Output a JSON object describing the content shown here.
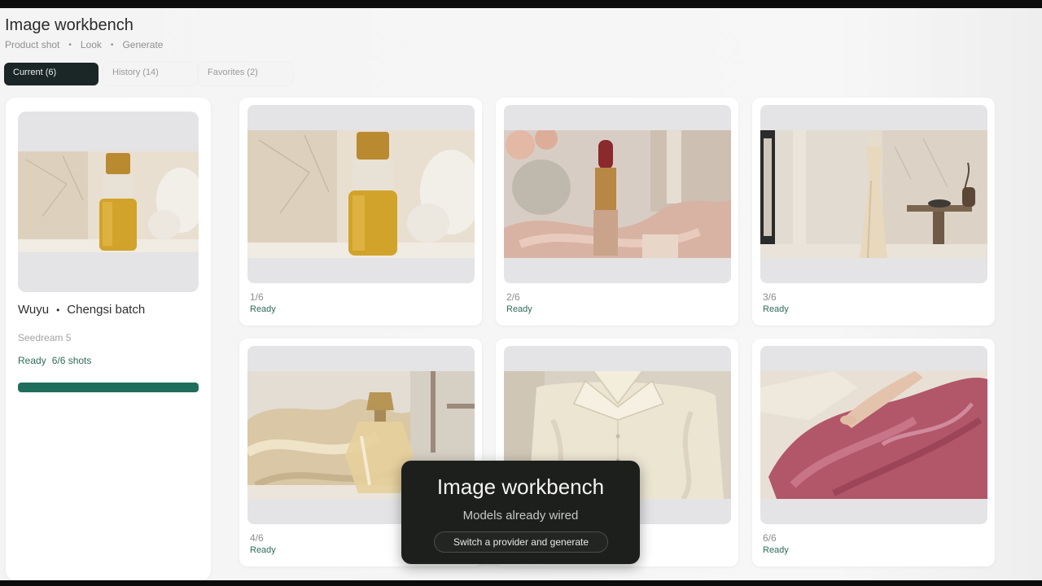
{
  "header": {
    "title": "Image workbench",
    "breadcrumb": [
      "Product shot",
      "Look",
      "Generate"
    ]
  },
  "tabs": [
    {
      "label": "Current (6)",
      "active": true
    },
    {
      "label": "History (14)",
      "active": false
    },
    {
      "label": "Favorites (2)",
      "active": false
    }
  ],
  "batch": {
    "brand": "Wuyu",
    "name": "Chengsi batch",
    "model": "Seedream 5",
    "status": "Ready",
    "count": "6/6 shots",
    "progress": 1.0,
    "thumbnail": "serum-bottle-marble"
  },
  "shots": [
    {
      "index": "1/6",
      "status": "Ready",
      "subject": "serum-bottle-marble"
    },
    {
      "index": "2/6",
      "status": "Ready",
      "subject": "lipstick-roses-ribbon"
    },
    {
      "index": "3/6",
      "status": "Ready",
      "subject": "satin-gown-mannequin"
    },
    {
      "index": "4/6",
      "status": "Ready",
      "subject": "perfume-bottle-silk"
    },
    {
      "index": "",
      "status": "",
      "subject": "folded-ivory-shirt"
    },
    {
      "index": "6/6",
      "status": "Ready",
      "subject": "rose-silk-fabric-hand"
    }
  ],
  "toast": {
    "title": "Image workbench",
    "subtitle": "Models already wired",
    "action": "Switch a provider and generate"
  },
  "colors": {
    "accent": "#1f6e5c",
    "ready": "#2f6b5a",
    "tab_active": "#1b2626",
    "toast_bg": "#1d1f1c"
  }
}
